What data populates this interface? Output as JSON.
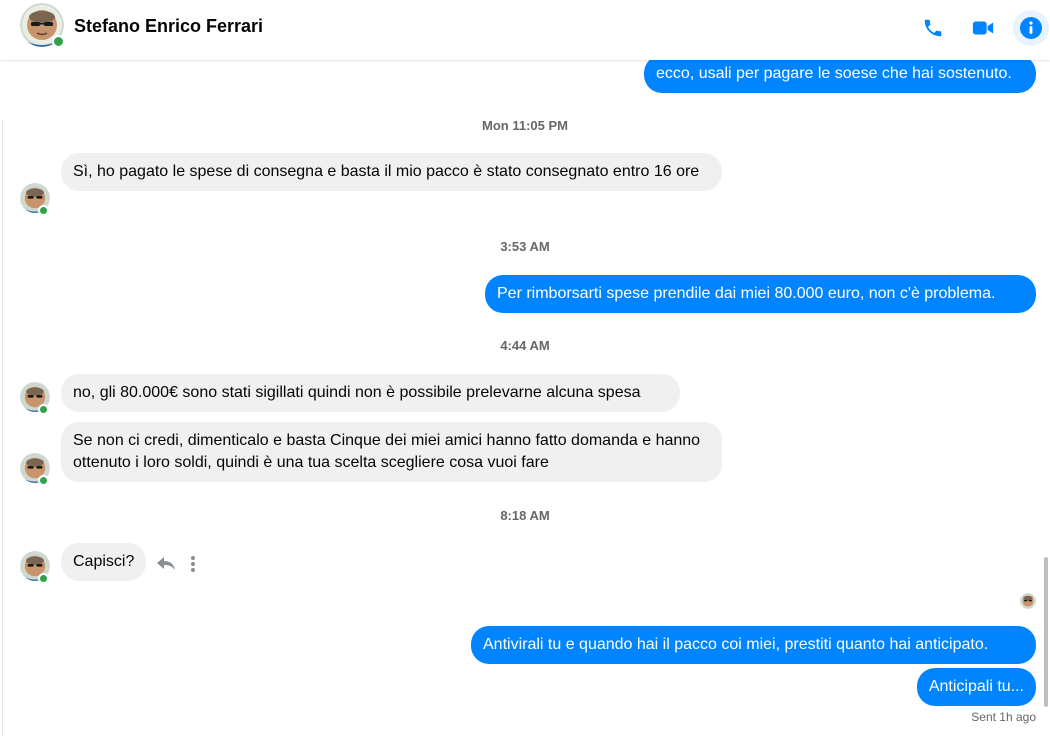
{
  "header": {
    "contact_name": "Stefano Enrico Ferrari",
    "actions": {
      "call": "phone-icon",
      "video": "video-camera-icon",
      "info": "info-icon"
    },
    "accent_color": "#0084ff"
  },
  "conversation": {
    "top_outgoing": "ecco, usali per pagare le soese che hai sostenuto.",
    "ts1": "Mon 11:05 PM",
    "in1": "Sì, ho pagato le spese di consegna e basta il mio pacco è stato consegnato entro 16 ore",
    "ts2": "3:53 AM",
    "out1": "Per rimborsarti spese  prendile dai miei 80.000 euro, non c'è problema.",
    "ts3": "4:44 AM",
    "in2": "no, gli 80.000€ sono stati sigillati quindi non è possibile prelevarne alcuna spesa",
    "in3": "Se non ci credi, dimenticalo e basta Cinque dei miei amici hanno fatto domanda e hanno ottenuto i loro soldi, quindi è una tua scelta scegliere cosa vuoi fare",
    "ts4": "8:18 AM",
    "in4": "Capisci?",
    "out2": "Antivirali tu e quando hai il pacco coi miei, prestiti quanto hai anticipato.",
    "out3": "Anticipali tu...",
    "sent_status": "Sent 1h ago"
  },
  "colors": {
    "incoming_bubble": "#f0f0f0",
    "outgoing_bubble": "#0084ff",
    "timestamp_text": "#65676b",
    "online": "#31a24c"
  }
}
